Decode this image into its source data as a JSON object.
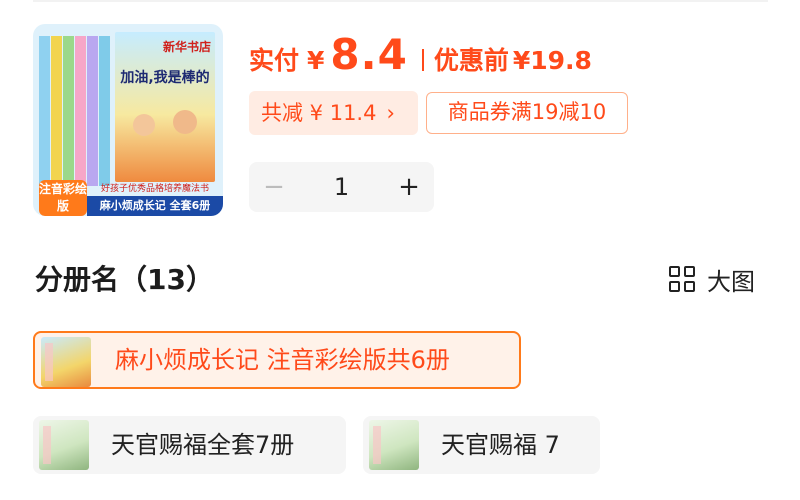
{
  "product": {
    "thumbnail": {
      "cover_title": "加油,我是棒的",
      "publisher": "新华书店",
      "badge": "注音彩绘版",
      "tagline": "好孩子优秀品格培养魔法书",
      "series": "麻小烦成长记 全套6册"
    },
    "price": {
      "label": "实付",
      "currency": "¥",
      "value": "8.4",
      "original_label": "优惠前",
      "original_value": "¥19.8"
    },
    "discount": {
      "label": "共减 ¥ 11.4",
      "chevron": "›"
    },
    "coupon": {
      "label": "商品券满19减10"
    },
    "quantity": {
      "minus": "−",
      "value": "1",
      "plus": "+"
    }
  },
  "volumes": {
    "title": "分册名（13）",
    "view_toggle": {
      "icon": "grid-icon",
      "label": "大图"
    },
    "items": [
      {
        "label": "麻小烦成长记 注音彩绘版共6册",
        "selected": true
      },
      {
        "label": "天官赐福全套7册",
        "selected": false
      },
      {
        "label": "天官赐福 7",
        "selected": false
      }
    ]
  },
  "colors": {
    "accent": "#ff4a1a",
    "accent_soft": "#ffece3",
    "selected_border": "#ff7a1a",
    "chip_bg": "#f5f5f5"
  }
}
